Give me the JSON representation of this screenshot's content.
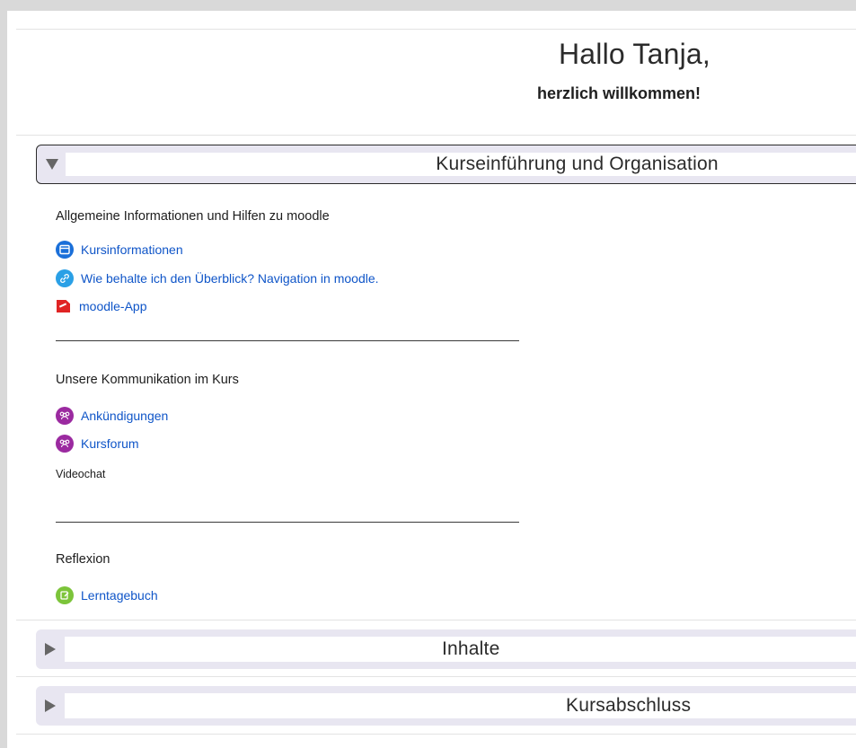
{
  "welcome": {
    "greeting": "Hallo Tanja,",
    "subtitle": "herzlich willkommen!"
  },
  "sections": [
    {
      "title": "Kurseinführung und Organisation",
      "expanded": true,
      "blocks": [
        {
          "heading": "Allgemeine Informationen und Hilfen zu moodle",
          "items": [
            {
              "label": "Kursinformationen",
              "icon": "page-icon"
            },
            {
              "label": "Wie behalte ich den Überblick? Navigation in moodle.",
              "icon": "link-icon"
            },
            {
              "label": "moodle-App",
              "icon": "pdf-icon"
            }
          ]
        },
        {
          "heading": "Unsere Kommunikation im Kurs",
          "items": [
            {
              "label": "Ankündigungen",
              "icon": "forum-icon"
            },
            {
              "label": "Kursforum",
              "icon": "forum-icon"
            }
          ],
          "note": "Videochat"
        },
        {
          "heading": "Reflexion",
          "items": [
            {
              "label": "Lerntagebuch",
              "icon": "journal-icon"
            }
          ]
        }
      ]
    },
    {
      "title": "Inhalte",
      "expanded": false
    },
    {
      "title": "Kursabschluss",
      "expanded": false
    }
  ],
  "colors": {
    "link": "#0f55c8",
    "section_bg": "#e8e6f1",
    "page_icon": "#1a6fd9",
    "link_icon": "#2aa0e6",
    "forum_icon": "#9b2aa0",
    "journal_icon": "#7cc43a",
    "pdf_icon": "#e02424"
  }
}
